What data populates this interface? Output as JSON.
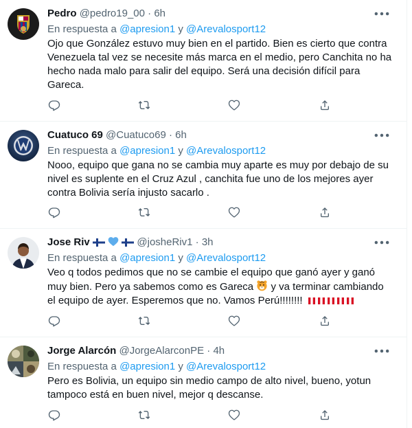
{
  "tweets": [
    {
      "name": "Pedro",
      "handle": "@pedro19_00",
      "sep": "·",
      "time": "6h",
      "reply_prefix": "En respuesta a ",
      "mention1": "@apresion1",
      "reply_join": " y ",
      "mention2": "@Arevalosport12",
      "text": "Ojo que González estuvo muy bien en el partido. Bien es cierto que contra Venezuela tal vez se necesite más marca en el medio, pero Canchita no ha hecho nada malo para salir del equipo. Será una decisión difícil para Gareca.",
      "avatar_icon": "barcelona-crest-avatar"
    },
    {
      "name": "Cuatuco 69",
      "handle": "@Cuatuco69",
      "sep": "·",
      "time": "6h",
      "reply_prefix": "En respuesta a ",
      "mention1": "@apresion1",
      "reply_join": " y ",
      "mention2": "@Arevalosport12",
      "text": "Nooo, equipo que gana no se cambia muy aparte es muy por debajo de su nivel es suplente en el Cruz Azul , canchita fue uno de los mejores ayer contra Bolivia sería injusto sacarlo .",
      "avatar_icon": "vw-logo-avatar"
    },
    {
      "name": "Jose Riv",
      "handle": "@josheRiv1",
      "sep": "·",
      "time": "3h",
      "reply_prefix": "En respuesta a ",
      "mention1": "@apresion1",
      "reply_join": " y ",
      "mention2": "@Arevalosport12",
      "text_part1": "Veo q todos pedimos que no se cambie el equipo que ganó ayer y ganó muy bien. Pero ya sabemos como es Gareca ",
      "text_part2": " y va terminar cambiando el equipo de ayer. Esperemos que no. Vamos Perú!!!!!!!!",
      "avatar_icon": "person-photo-avatar"
    },
    {
      "name": "Jorge Alarcón",
      "handle": "@JorgeAlarconPE",
      "sep": "·",
      "time": "4h",
      "reply_prefix": "En respuesta a ",
      "mention1": "@apresion1",
      "reply_join": " y ",
      "mention2": "@Arevalosport12",
      "text": "Pero es Bolivia, un equipo sin medio campo de alto nivel, bueno, yotun tampoco está en buen nivel, mejor q descanse.",
      "avatar_icon": "collage-photo-avatar"
    }
  ],
  "icons": {
    "more": "more-icon",
    "reply": "reply-icon",
    "retweet": "retweet-icon",
    "like": "like-icon",
    "share": "share-icon"
  },
  "colors": {
    "text": "#0f1419",
    "secondary": "#536471",
    "link": "#1d9bf0",
    "divider": "#eff3f4",
    "peru_red": "#d91023"
  }
}
